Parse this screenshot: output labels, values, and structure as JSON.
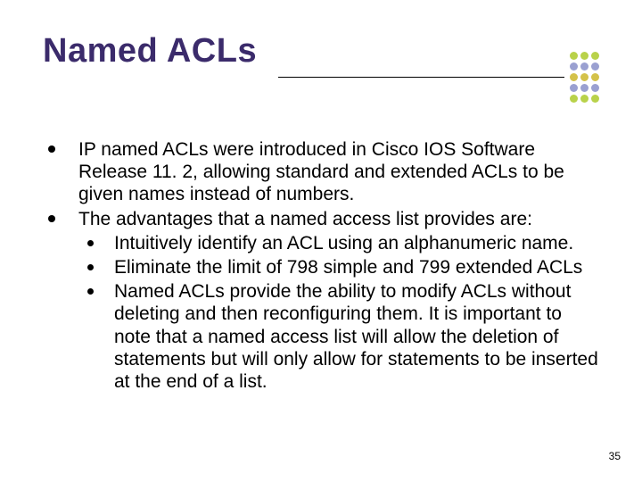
{
  "title": "Named ACLs",
  "bullets": {
    "b1": "IP named ACLs were introduced in Cisco IOS Software Release 11. 2, allowing standard and extended ACLs to be given names instead of numbers.",
    "b2": "The advantages that a named access list provides are:",
    "b2a": "Intuitively identify an ACL using an alphanumeric name.",
    "b2b": "Eliminate the limit of 798 simple and 799 extended ACLs",
    "b2c": "Named ACLs provide the ability to modify ACLs without deleting and then reconfiguring them. It is important to note that a named access list will allow the deletion of statements but will only allow for statements to be inserted at the end of a list."
  },
  "page_number": "35",
  "dot_colors": [
    "#b9d24a",
    "#b9d24a",
    "#b9d24a",
    "#9aa0d1",
    "#9aa0d1",
    "#9aa0d1",
    "#d4c24a",
    "#d4c24a",
    "#d4c24a",
    "#9aa0d1",
    "#9aa0d1",
    "#9aa0d1",
    "#b9d24a",
    "#b9d24a",
    "#b9d24a"
  ]
}
